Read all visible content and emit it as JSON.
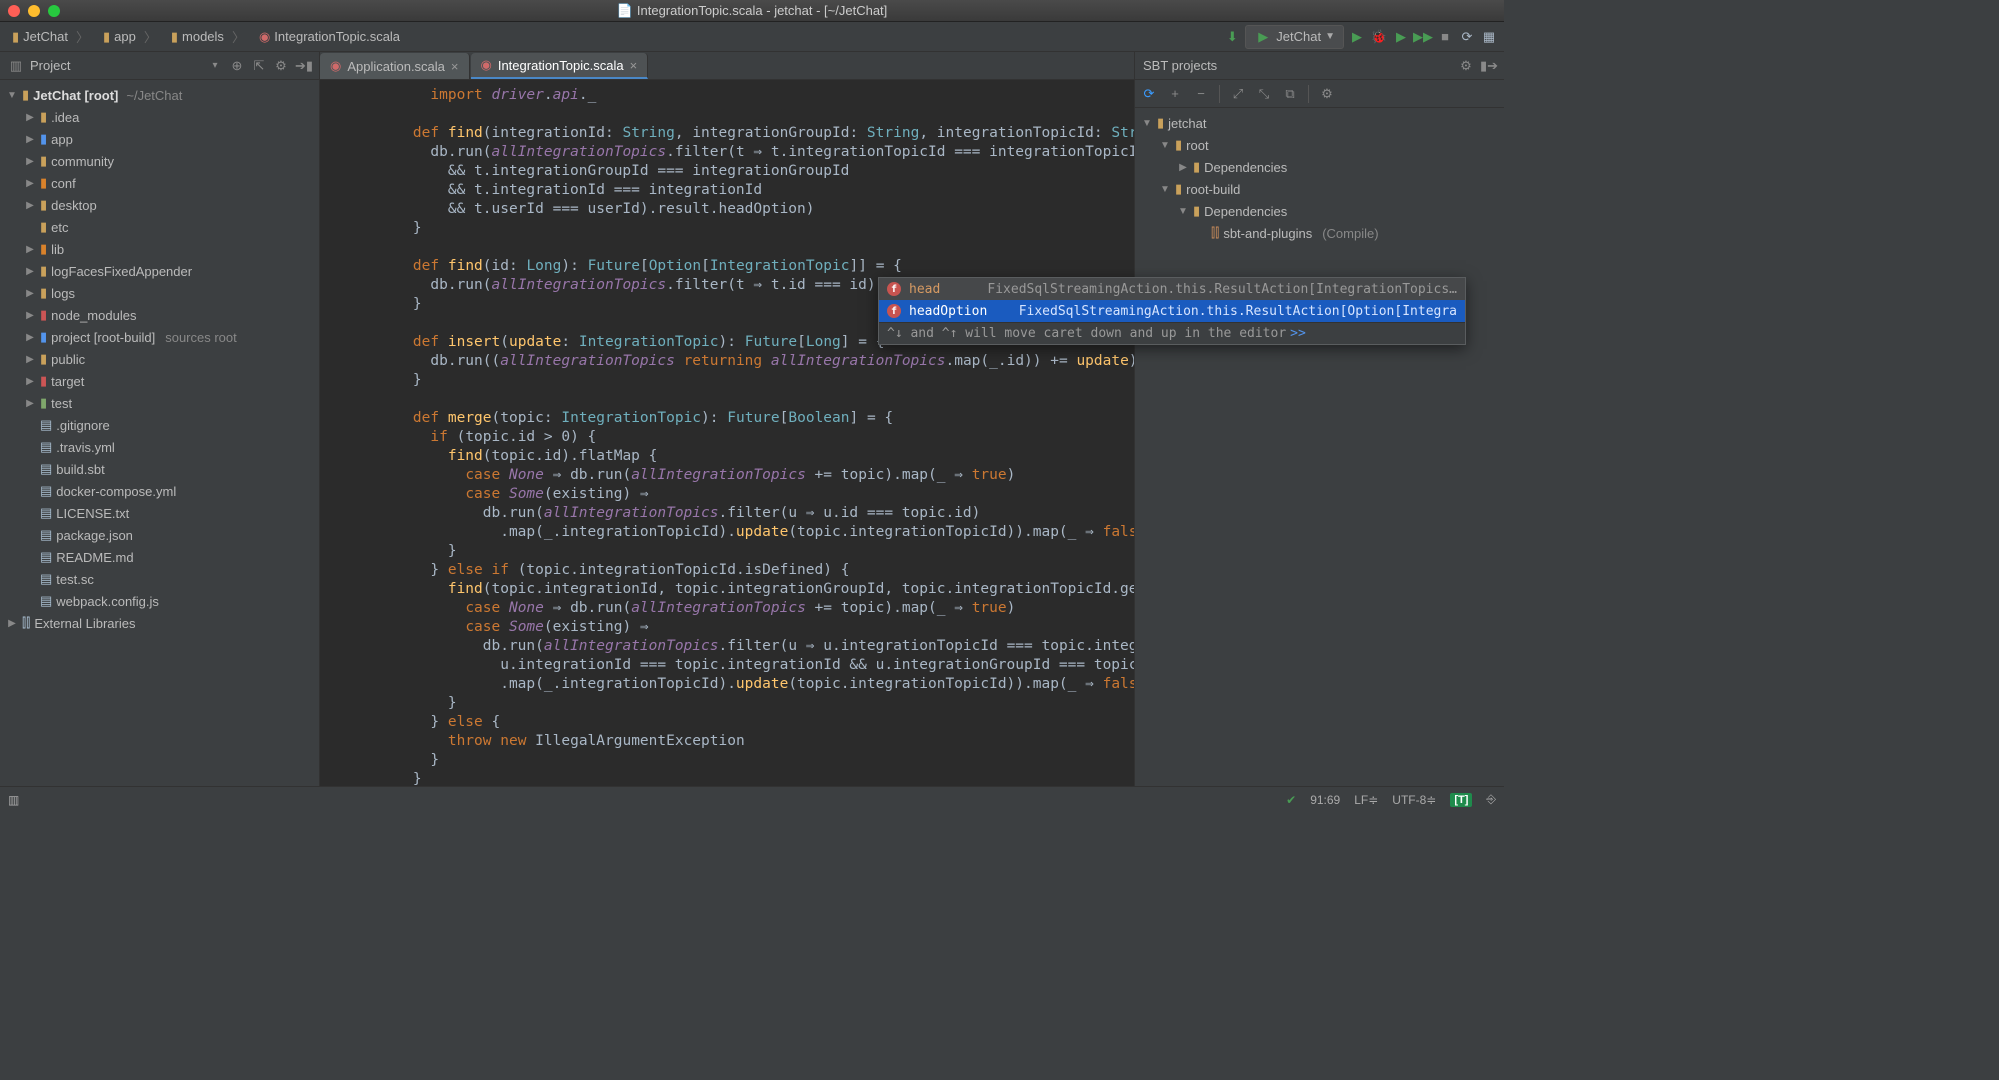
{
  "window": {
    "title": "IntegrationTopic.scala - jetchat - [~/JetChat]"
  },
  "breadcrumbs": [
    {
      "label": "JetChat",
      "icon": "folder"
    },
    {
      "label": "app",
      "icon": "folder"
    },
    {
      "label": "models",
      "icon": "folder"
    },
    {
      "label": "IntegrationTopic.scala",
      "icon": "scala"
    }
  ],
  "run_config": "JetChat",
  "project_panel": {
    "title": "Project"
  },
  "tree": {
    "root": {
      "label": "JetChat [root]",
      "path": "~/JetChat"
    },
    "items": [
      {
        "depth": 1,
        "arrow": "▶",
        "icon": "folder",
        "label": ".idea"
      },
      {
        "depth": 1,
        "arrow": "▶",
        "icon": "folder-blue",
        "label": "app"
      },
      {
        "depth": 1,
        "arrow": "▶",
        "icon": "folder",
        "label": "community"
      },
      {
        "depth": 1,
        "arrow": "▶",
        "icon": "folder-orange",
        "label": "conf"
      },
      {
        "depth": 1,
        "arrow": "▶",
        "icon": "folder",
        "label": "desktop"
      },
      {
        "depth": 1,
        "arrow": "",
        "icon": "folder",
        "label": "etc"
      },
      {
        "depth": 1,
        "arrow": "▶",
        "icon": "folder-orange",
        "label": "lib"
      },
      {
        "depth": 1,
        "arrow": "▶",
        "icon": "folder",
        "label": "logFacesFixedAppender"
      },
      {
        "depth": 1,
        "arrow": "▶",
        "icon": "folder",
        "label": "logs"
      },
      {
        "depth": 1,
        "arrow": "▶",
        "icon": "folder-red",
        "label": "node_modules"
      },
      {
        "depth": 1,
        "arrow": "▶",
        "icon": "folder-blue",
        "label": "project [root-build]",
        "tail": "sources root"
      },
      {
        "depth": 1,
        "arrow": "▶",
        "icon": "folder",
        "label": "public"
      },
      {
        "depth": 1,
        "arrow": "▶",
        "icon": "folder-red",
        "label": "target"
      },
      {
        "depth": 1,
        "arrow": "▶",
        "icon": "folder-green",
        "label": "test"
      },
      {
        "depth": 1,
        "arrow": "",
        "icon": "file",
        "label": ".gitignore"
      },
      {
        "depth": 1,
        "arrow": "",
        "icon": "file",
        "label": ".travis.yml"
      },
      {
        "depth": 1,
        "arrow": "",
        "icon": "file",
        "label": "build.sbt"
      },
      {
        "depth": 1,
        "arrow": "",
        "icon": "file",
        "label": "docker-compose.yml"
      },
      {
        "depth": 1,
        "arrow": "",
        "icon": "file",
        "label": "LICENSE.txt"
      },
      {
        "depth": 1,
        "arrow": "",
        "icon": "file",
        "label": "package.json"
      },
      {
        "depth": 1,
        "arrow": "",
        "icon": "file",
        "label": "README.md"
      },
      {
        "depth": 1,
        "arrow": "",
        "icon": "file",
        "label": "test.sc"
      },
      {
        "depth": 1,
        "arrow": "",
        "icon": "file",
        "label": "webpack.config.js"
      }
    ],
    "external": "External Libraries"
  },
  "tabs": [
    {
      "label": "Application.scala",
      "active": false
    },
    {
      "label": "IntegrationTopic.scala",
      "active": true
    }
  ],
  "sbt": {
    "title": "SBT projects",
    "nodes": [
      {
        "depth": 0,
        "arrow": "▼",
        "icon": "folder",
        "label": "jetchat"
      },
      {
        "depth": 1,
        "arrow": "▼",
        "icon": "module",
        "label": "root"
      },
      {
        "depth": 2,
        "arrow": "▶",
        "icon": "module",
        "label": "Dependencies"
      },
      {
        "depth": 1,
        "arrow": "▼",
        "icon": "module",
        "label": "root-build"
      },
      {
        "depth": 2,
        "arrow": "▼",
        "icon": "module",
        "label": "Dependencies"
      },
      {
        "depth": 3,
        "arrow": "",
        "icon": "lib",
        "label": "sbt-and-plugins",
        "tail": "(Compile)"
      }
    ]
  },
  "completion": {
    "items": [
      {
        "name": "head",
        "type": "FixedSqlStreamingAction.this.ResultAction[IntegrationTopics…",
        "selected": false
      },
      {
        "name": "headOption",
        "type": "FixedSqlStreamingAction.this.ResultAction[Option[Integra",
        "selected": true
      }
    ],
    "hint_pre": "^↓ and ^↑ will move caret down and up in the editor",
    "hint_link": ">>"
  },
  "status": {
    "caret": "91:69",
    "line_sep": "LF≑",
    "encoding": "UTF-8≑",
    "insert_badge": "⎆"
  },
  "code": {
    "lines": [
      {
        "t": "      import driver.api._"
      },
      {
        "t": ""
      },
      {
        "t": "    def find(integrationId: String, integrationGroupId: String, integrationTopicId: String, u"
      },
      {
        "t": "      db.run(allIntegrationTopics.filter(t ⇒ t.integrationTopicId === integrationTopicId"
      },
      {
        "t": "        && t.integrationGroupId === integrationGroupId"
      },
      {
        "t": "        && t.integrationId === integrationId"
      },
      {
        "t": "        && t.userId === userId).result.headOption)"
      },
      {
        "t": "    }"
      },
      {
        "t": ""
      },
      {
        "t": "    def find(id: Long): Future[Option[IntegrationTopic]] = {"
      },
      {
        "t": "      db.run(allIntegrationTopics.filter(t ⇒ t.id === id).result.head)"
      },
      {
        "t": "    }"
      },
      {
        "t": ""
      },
      {
        "t": "    def insert(update: IntegrationTopic): Future[Long] = {"
      },
      {
        "t": "      db.run((allIntegrationTopics returning allIntegrationTopics.map(_.id)) += update)"
      },
      {
        "t": "    }"
      },
      {
        "t": ""
      },
      {
        "t": "    def merge(topic: IntegrationTopic): Future[Boolean] = {"
      },
      {
        "t": "      if (topic.id > 0) {"
      },
      {
        "t": "        find(topic.id).flatMap {"
      },
      {
        "t": "          case None ⇒ db.run(allIntegrationTopics += topic).map(_ ⇒ true)"
      },
      {
        "t": "          case Some(existing) ⇒"
      },
      {
        "t": "            db.run(allIntegrationTopics.filter(u ⇒ u.id === topic.id)"
      },
      {
        "t": "              .map(_.integrationTopicId).update(topic.integrationTopicId)).map(_ ⇒ false)"
      },
      {
        "t": "        }"
      },
      {
        "t": "      } else if (topic.integrationTopicId.isDefined) {"
      },
      {
        "t": "        find(topic.integrationId, topic.integrationGroupId, topic.integrationTopicId.get, top"
      },
      {
        "t": "          case None ⇒ db.run(allIntegrationTopics += topic).map(_ ⇒ true)"
      },
      {
        "t": "          case Some(existing) ⇒"
      },
      {
        "t": "            db.run(allIntegrationTopics.filter(u ⇒ u.integrationTopicId === topic.integratio"
      },
      {
        "t": "              u.integrationId === topic.integrationId && u.integrationGroupId === topic.integ"
      },
      {
        "t": "              .map(_.integrationTopicId).update(topic.integrationTopicId)).map(_ ⇒ false)"
      },
      {
        "t": "        }"
      },
      {
        "t": "      } else {"
      },
      {
        "t": "        throw new IllegalArgumentException"
      },
      {
        "t": "      }"
      },
      {
        "t": "    }"
      }
    ]
  }
}
